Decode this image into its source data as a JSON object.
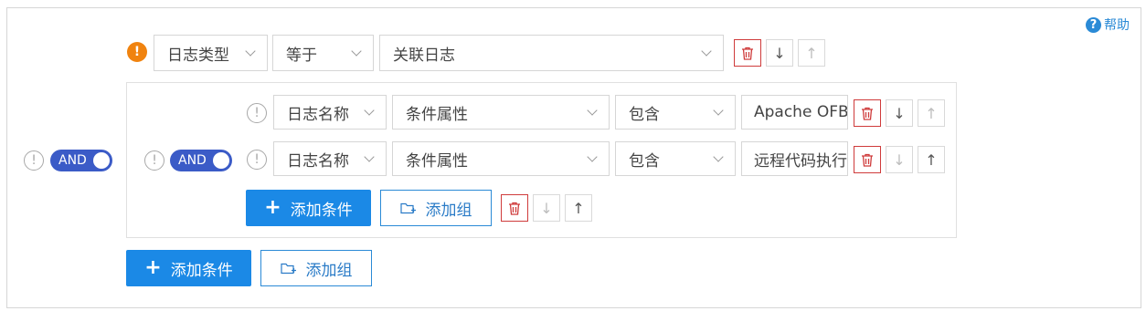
{
  "help": {
    "label": "帮助"
  },
  "outer": {
    "logic": "AND",
    "condition": {
      "field": "日志类型",
      "operator": "等于",
      "value": "关联日志"
    },
    "add_condition": "添加条件",
    "add_group": "添加组"
  },
  "inner": {
    "logic": "AND",
    "rows": [
      {
        "field": "日志名称",
        "attr": "条件属性",
        "operator": "包含",
        "value": "Apache OFBiz"
      },
      {
        "field": "日志名称",
        "attr": "条件属性",
        "operator": "包含",
        "value": "远程代码执行"
      }
    ],
    "add_condition": "添加条件",
    "add_group": "添加组"
  },
  "icons": {
    "warning": "!",
    "move_down": "↓",
    "move_up": "↑"
  },
  "colors": {
    "accent": "#1b89e6",
    "toggle": "#3b5bc7",
    "danger": "#cf3b3b",
    "warning": "#f0830f"
  }
}
